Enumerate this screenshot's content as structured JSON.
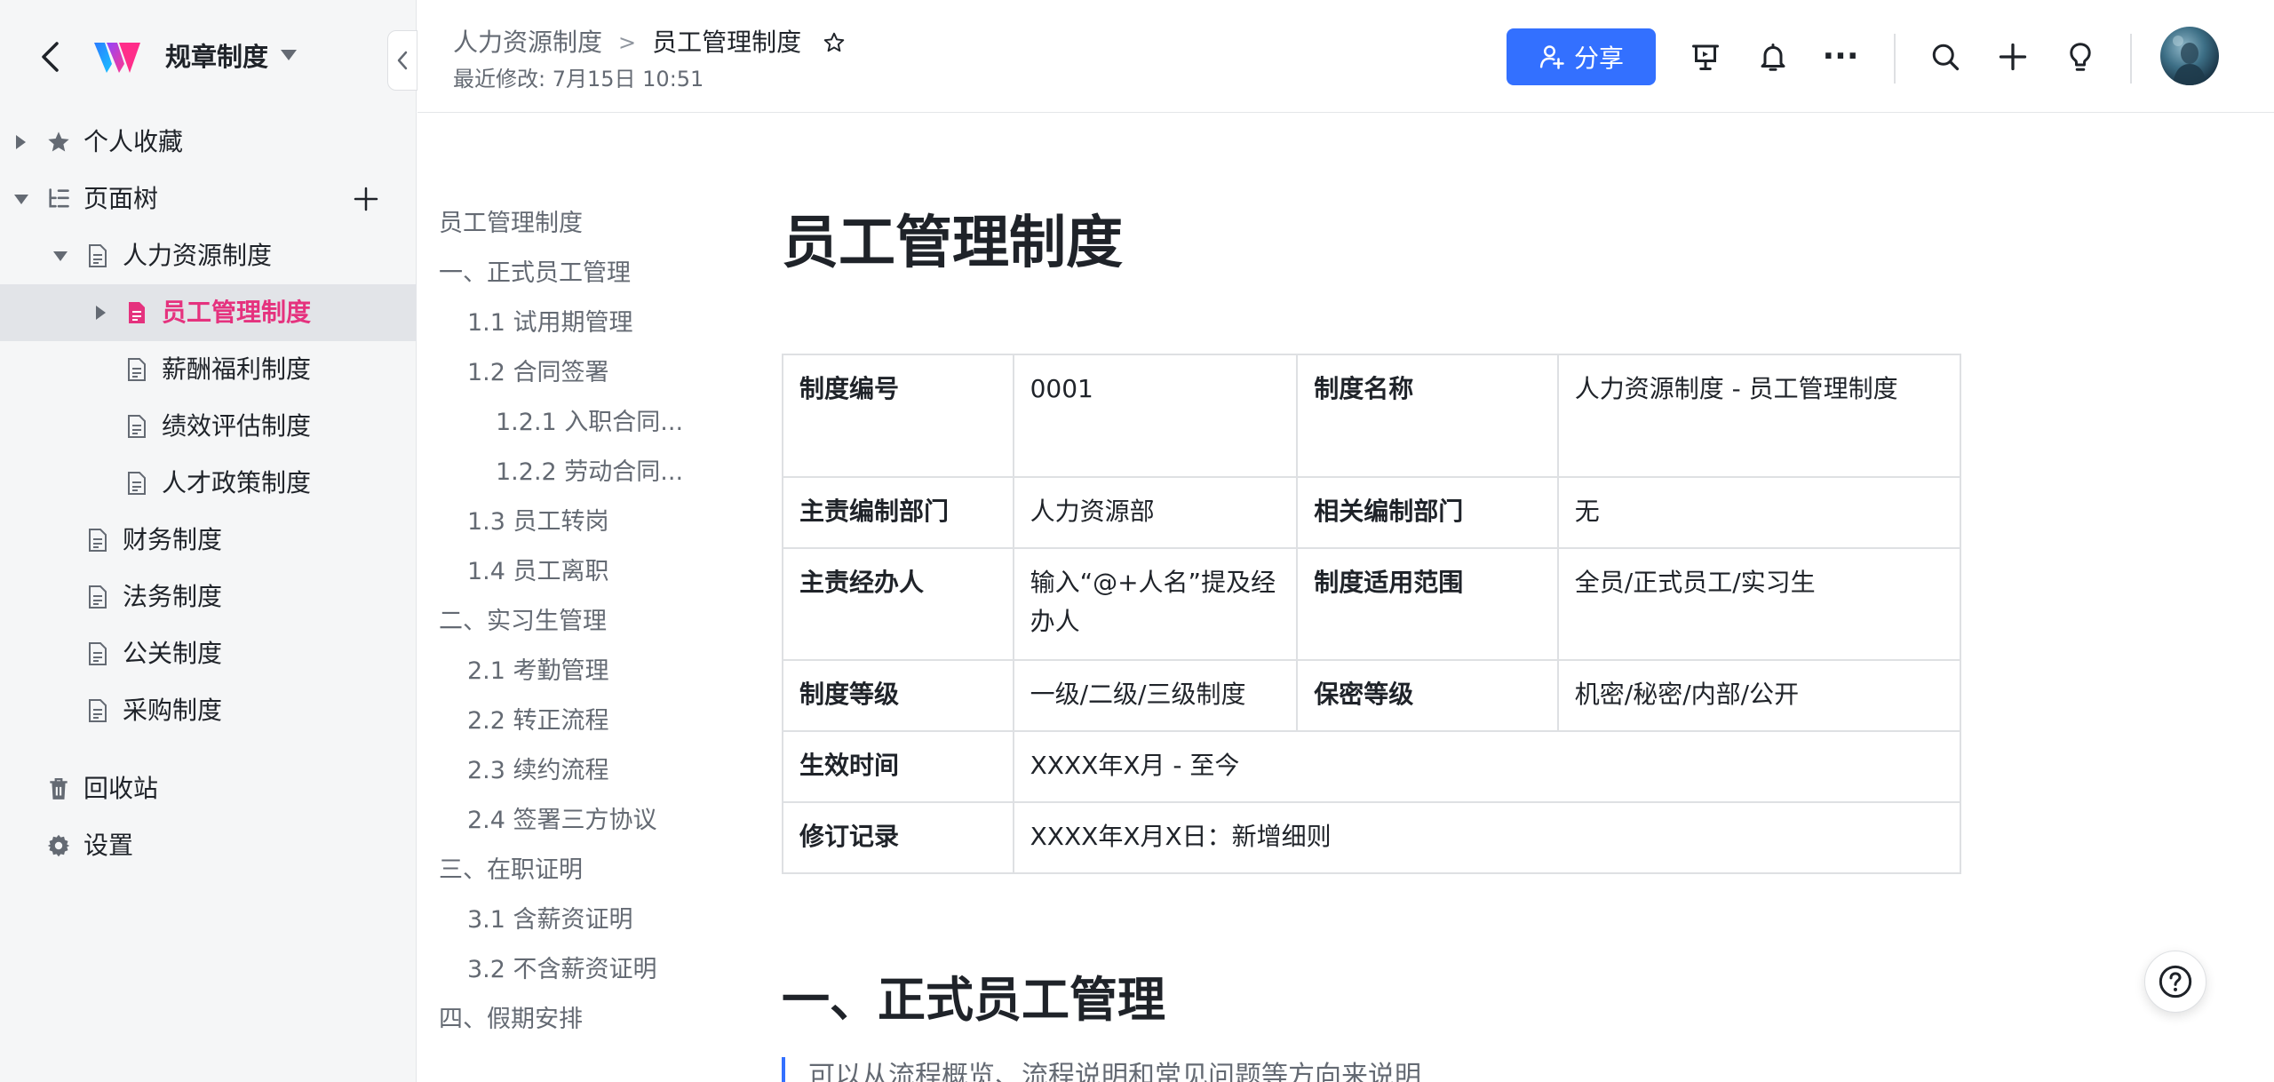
{
  "sidebar": {
    "space_title": "规章制度",
    "tree": [
      {
        "label": "个人收藏",
        "icon": "star-icon"
      },
      {
        "label": "页面树",
        "icon": "tree-icon"
      },
      {
        "label": "人力资源制度",
        "icon": "document-icon"
      },
      {
        "label": "员工管理制度",
        "icon": "document-icon",
        "active": true
      },
      {
        "label": "薪酬福利制度",
        "icon": "document-icon"
      },
      {
        "label": "绩效评估制度",
        "icon": "document-icon"
      },
      {
        "label": "人才政策制度",
        "icon": "document-icon"
      },
      {
        "label": "财务制度",
        "icon": "document-icon"
      },
      {
        "label": "法务制度",
        "icon": "document-icon"
      },
      {
        "label": "公关制度",
        "icon": "document-icon"
      },
      {
        "label": "采购制度",
        "icon": "document-icon"
      }
    ],
    "bottom": [
      {
        "label": "回收站",
        "icon": "trash-icon"
      },
      {
        "label": "设置",
        "icon": "gear-icon"
      }
    ]
  },
  "header": {
    "breadcrumb_parent": "人力资源制度",
    "breadcrumb_separator": ">",
    "breadcrumb_current": "员工管理制度",
    "last_modified": "最近修改: 7月15日 10:51",
    "share_label": "分享",
    "more_label": "···"
  },
  "outline": [
    "员工管理制度",
    "一、正式员工管理",
    "1.1 试用期管理",
    "1.2 合同签署",
    "1.2.1 入职合同...",
    "1.2.2 劳动合同...",
    "1.3 员工转岗",
    "1.4 员工离职",
    "二、实习生管理",
    "2.1 考勤管理",
    "2.2 转正流程",
    "2.3 续约流程",
    "2.4 签署三方协议",
    "三、在职证明",
    "3.1 含薪资证明",
    "3.2 不含薪资证明",
    "四、假期安排"
  ],
  "document": {
    "title": "员工管理制度",
    "table": {
      "r1": {
        "k1": "制度编号",
        "v1": "0001",
        "k2": "制度名称",
        "v2": "人力资源制度 - 员工管理制度"
      },
      "r2": {
        "k1": "主责编制部门",
        "v1": "人力资源部",
        "k2": "相关编制部门",
        "v2": "无"
      },
      "r3": {
        "k1": "主责经办人",
        "v1": "输入“@+人名”提及经办人",
        "k2": "制度适用范围",
        "v2": "全员/正式员工/实习生"
      },
      "r4": {
        "k1": "制度等级",
        "v1": "一级/二级/三级制度",
        "k2": "保密等级",
        "v2": "机密/秘密/内部/公开"
      },
      "r5": {
        "k1": "生效时间",
        "v1": "XXXX年X月 - 至今"
      },
      "r6": {
        "k1": "修订记录",
        "v1": "XXXX年X月X日：新增细则"
      }
    },
    "section1_heading": "一、正式员工管理",
    "section1_quote": "可以从流程概览、流程说明和常见问题等方向来说明"
  },
  "help_label": "?",
  "colors": {
    "accent": "#3370ff",
    "active_item": "#e5327e",
    "sidebar_bg": "#f5f6f7"
  }
}
